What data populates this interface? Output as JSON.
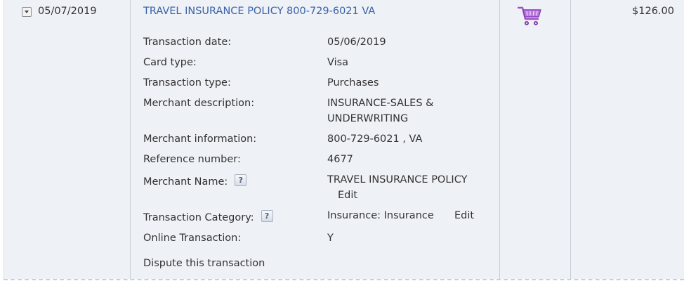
{
  "row": {
    "posting_date": "05/07/2019",
    "title": "TRAVEL INSURANCE POLICY 800-729-6021 VA",
    "amount": "$126.00",
    "icon": "shopping-cart-icon"
  },
  "details": {
    "transaction_date": {
      "label": "Transaction date:",
      "value": "05/06/2019"
    },
    "card_type": {
      "label": "Card type:",
      "value": "Visa"
    },
    "transaction_type": {
      "label": "Transaction type:",
      "value": "Purchases"
    },
    "merchant_description": {
      "label": "Merchant description:",
      "value_line1": "INSURANCE-SALES &",
      "value_line2": "UNDERWRITING"
    },
    "merchant_information": {
      "label": "Merchant information:",
      "value": "800-729-6021 , VA"
    },
    "reference_number": {
      "label": "Reference number:",
      "value": "4677"
    },
    "merchant_name": {
      "label": "Merchant Name:",
      "help": "?",
      "value": "TRAVEL INSURANCE POLICY",
      "edit": "Edit"
    },
    "transaction_category": {
      "label": "Transaction Category:",
      "help": "?",
      "value": "Insurance: Insurance",
      "edit": "Edit"
    },
    "online_transaction": {
      "label": "Online Transaction:",
      "value": "Y"
    }
  },
  "dispute_link": "Dispute this transaction",
  "colors": {
    "link": "#3a62a8",
    "row_bg": "#eef1f6",
    "cart": "#9b4fc9"
  }
}
